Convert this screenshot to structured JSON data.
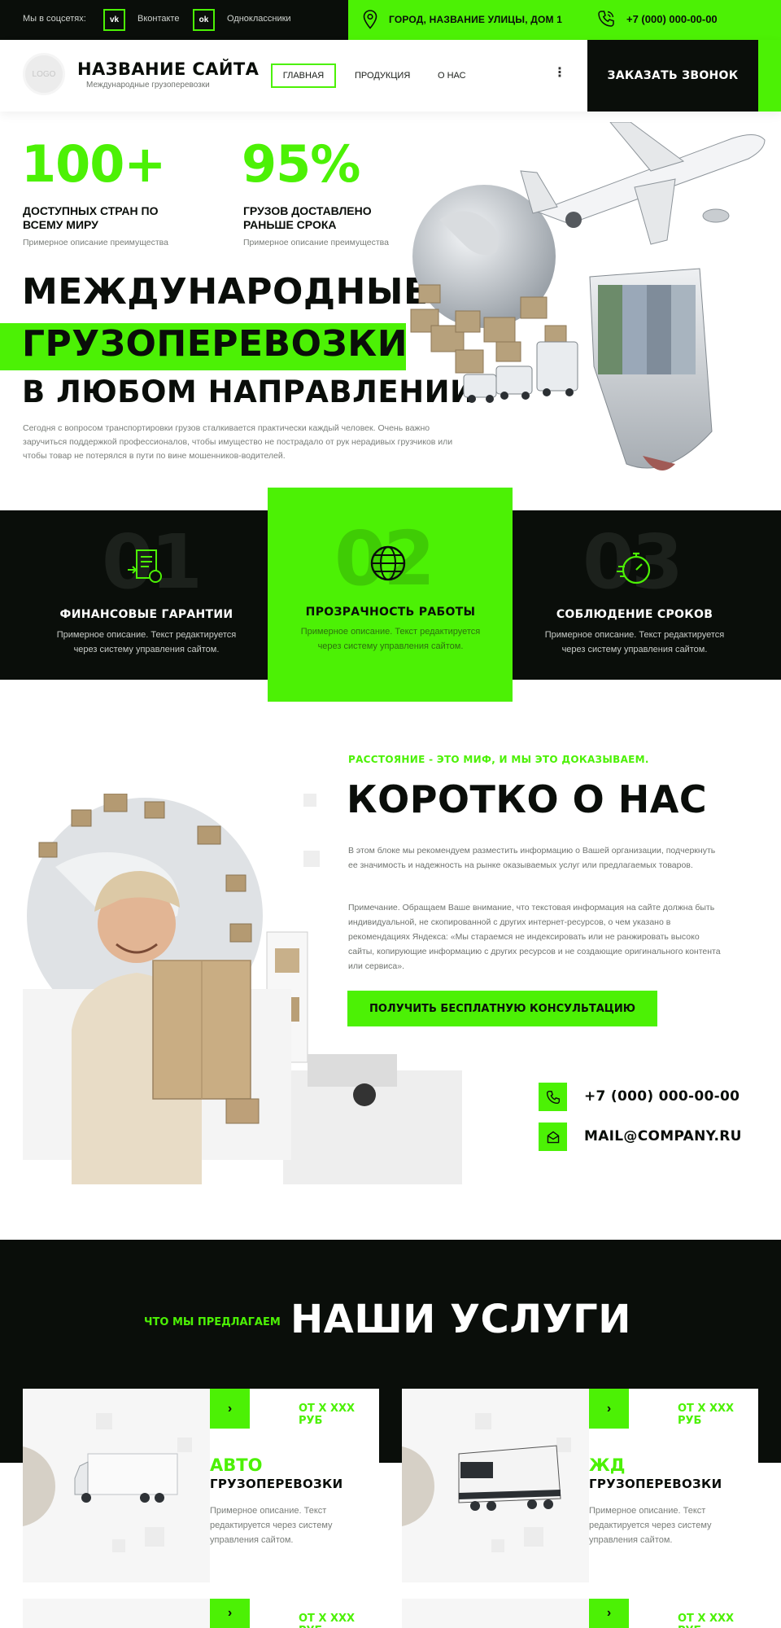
{
  "topbar": {
    "social_label": "Мы в соцсетях:",
    "social": [
      {
        "icon": "vk-icon",
        "glyph": "vk",
        "label": "Вконтакте"
      },
      {
        "icon": "ok-icon",
        "glyph": "ok",
        "label": "Одноклассники"
      }
    ],
    "address": "ГОРОД, НАЗВАНИЕ УЛИЦЫ, ДОМ 1",
    "phone": "+7 (000) 000-00-00"
  },
  "header": {
    "logo_text": "LOGO",
    "title": "НАЗВАНИЕ САЙТА",
    "subtitle": "Международные грузоперевозки",
    "nav": [
      "ГЛАВНАЯ",
      "ПРОДУКЦИЯ",
      "О НАС"
    ],
    "more_glyph": "⋮",
    "callback_label": "ЗАКАЗАТЬ ЗВОНОК"
  },
  "hero": {
    "stats": [
      {
        "value": "100+",
        "title_lines": [
          "ДОСТУПНЫХ СТРАН ПО",
          "ВСЕМУ МИРУ"
        ],
        "desc": "Примерное описание преимущества"
      },
      {
        "value": "95%",
        "title_lines": [
          "ГРУЗОВ ДОСТАВЛЕНО",
          "РАНЬШЕ СРОКА"
        ],
        "desc": "Примерное описание преимущества"
      }
    ],
    "headline": [
      "МЕЖДУНАРОДНЫЕ",
      "ГРУЗОПЕРЕВОЗКИ",
      "В ЛЮБОМ НАПРАВЛЕНИИ"
    ],
    "description": "Сегодня с вопросом транспортировки грузов сталкивается практически каждый человек. Очень важно заручиться поддержкой профессионалов, чтобы имущество не пострадало от рук нерадивых грузчиков или чтобы товар не потерялся в пути по вине мошенников-водителей."
  },
  "features": [
    {
      "num": "01",
      "icon": "finance-document-icon",
      "title": "ФИНАНСОВЫЕ ГАРАНТИИ",
      "desc_lines": [
        "Примерное описание. Текст редактируется",
        "через систему управления сайтом."
      ]
    },
    {
      "num": "02",
      "icon": "globe-icon",
      "title": "ПРОЗРАЧНОСТЬ РАБОТЫ",
      "desc_lines": [
        "Примерное описание. Текст редактируется",
        "через систему управления сайтом."
      ]
    },
    {
      "num": "03",
      "icon": "stopwatch-icon",
      "title": "СОБЛЮДЕНИЕ СРОКОВ",
      "desc_lines": [
        "Примерное описание. Текст редактируется",
        "через систему управления сайтом."
      ]
    }
  ],
  "about": {
    "kicker": "РАССТОЯНИЕ - ЭТО МИФ, И МЫ ЭТО ДОКАЗЫВАЕМ.",
    "title": "КОРОТКО О НАС",
    "para1": "В этом блоке мы рекомендуем разместить информацию о Вашей организации, подчеркнуть ее значимость и надежность на рынке оказываемых услуг или предлагаемых товаров.",
    "para2": "Примечание. Обращаем Ваше внимание, что текстовая информация на сайте должна быть индивидуальной, не скопированной с других интернет-ресурсов, о чем указано в рекомендациях Яндекса: «Мы стараемся не индексировать или не ранжировать высоко сайты, копирующие информацию с других ресурсов и не создающие оригинального контента или сервиса».",
    "cta": "ПОЛУЧИТЬ БЕСПЛАТНУЮ КОНСУЛЬТАЦИЮ",
    "phone": "+7 (000) 000-00-00",
    "email": "MAIL@COMPANY.RU"
  },
  "services": {
    "kicker": "ЧТО МЫ ПРЕДЛАГАЕМ",
    "title": "НАШИ УСЛУГИ",
    "cards": [
      {
        "price": "ОТ Х ХХХ РУБ",
        "kind": "АВТО",
        "sub": "ГРУЗОПЕРЕВОЗКИ",
        "desc": "Примерное описание. Текст редактируется через систему управления сайтом.",
        "image": "truck-icon"
      },
      {
        "price": "ОТ Х ХХХ РУБ",
        "kind": "ЖД",
        "sub": "ГРУЗОПЕРЕВОЗКИ",
        "desc": "Примерное описание. Текст редактируется через систему управления сайтом.",
        "image": "train-icon"
      },
      {
        "price": "ОТ Х ХХХ РУБ"
      },
      {
        "price": "ОТ Х ХХХ РУБ"
      }
    ],
    "arrow_glyph": "›"
  },
  "colors": {
    "accent": "#4cf105",
    "dark": "#0a0e0a",
    "muted": "#7a7e7a"
  }
}
